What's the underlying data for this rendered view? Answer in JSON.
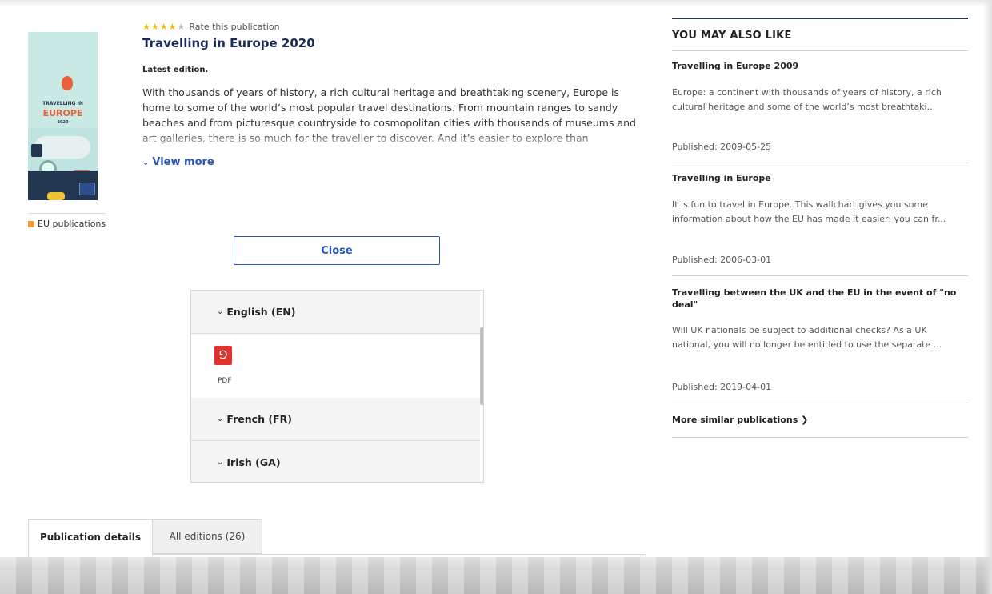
{
  "publication": {
    "rating_label": "Rate this publication",
    "rating_value": 4,
    "rating_max": 5,
    "title": "Travelling in Europe 2020",
    "edition": "Latest edition.",
    "description": "With thousands of years of history, a rich cultural heritage and breathtaking scenery, Europe is home to some of the world’s most popular travel destinations. From mountain ranges to sandy beaches and from picturesque countryside to cosmopolitan cities with thousands of museums and art galleries, there is so much for the traveller to discover. And it’s easier to explore than",
    "view_more": "View more",
    "category": "EU publications",
    "cover": {
      "title_line1": "TRAVELLING IN",
      "title_line2": "EUROPE",
      "year": "2020"
    }
  },
  "actions": {
    "close_label": "Close"
  },
  "languages": [
    {
      "label": "English (EN)",
      "expanded": true,
      "formats": [
        {
          "icon": "pdf-icon",
          "label": "PDF"
        }
      ]
    },
    {
      "label": "French (FR)",
      "expanded": false
    },
    {
      "label": "Irish (GA)",
      "expanded": false
    }
  ],
  "tabs": [
    {
      "label": "Publication details",
      "active": true
    },
    {
      "label": "All editions (26)",
      "active": false
    }
  ],
  "sidebar": {
    "heading": "YOU MAY ALSO LIKE",
    "items": [
      {
        "title": "Travelling in Europe 2009",
        "description": "Europe: a continent with thousands of years of history, a rich cultural heritage and some of the world’s most breathtaki...",
        "date": "Published: 2009-05-25"
      },
      {
        "title": "Travelling in Europe",
        "description": "It is fun to travel in Europe. This wallchart gives you some information about how the EU has made it easier: you can fr...",
        "date": "Published: 2006-03-01"
      },
      {
        "title": "Travelling between the UK and the EU in the event of \"no deal\"",
        "description": "Will UK nationals be subject to additional checks? As a UK national, you will no longer be entitled to use the separate ...",
        "date": "Published: 2019-04-01"
      }
    ],
    "more_link": "More similar publications"
  },
  "colors": {
    "accent": "#2a56b5",
    "title_navy": "#1a2b55",
    "star": "#f5b800",
    "pdf_red": "#e2322e",
    "category_orange": "#f29a32"
  }
}
